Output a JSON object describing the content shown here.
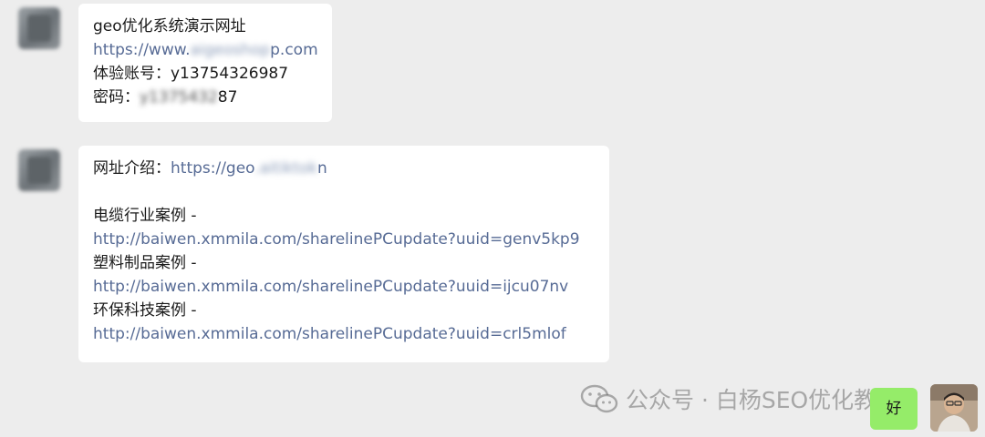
{
  "messages": [
    {
      "lines": [
        {
          "text": "geo优化系统演示网址"
        },
        {
          "prefix": "https://www.",
          "blur": "aigeoshop",
          "suffix": "p.com"
        },
        {
          "text": "体验账号：y13754326987"
        },
        {
          "label": "密码：",
          "blur": "y1375432",
          "suffix": "87"
        }
      ]
    },
    {
      "intro": {
        "label": "网址介绍：",
        "prefix": "https://geo",
        "blur": ".aitiktok",
        "suffix": "n"
      },
      "cases": [
        {
          "title": "电缆行业案例 -",
          "url": "http://baiwen.xmmila.com/sharelinePCupdate?uuid=genv5kp9"
        },
        {
          "title": "塑料制品案例 -",
          "url": "http://baiwen.xmmila.com/sharelinePCupdate?uuid=ijcu07nv"
        },
        {
          "title": "环保科技案例 -",
          "url": "http://baiwen.xmmila.com/sharelinePCupdate?uuid=crl5mlof"
        }
      ]
    }
  ],
  "sent": {
    "text": "好"
  },
  "watermark": {
    "text": "公众号 · 白杨SEO优化教程",
    "icon": "wechat-icon"
  },
  "colors": {
    "background": "#ededed",
    "bubble": "#ffffff",
    "sent_bubble": "#95ec69",
    "link": "#576b95"
  }
}
